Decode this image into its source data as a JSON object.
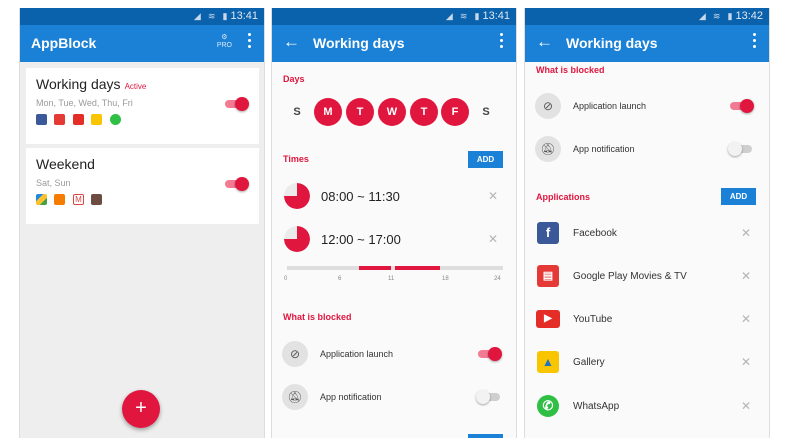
{
  "status": {
    "time1": "13:41",
    "time2": "13:41",
    "time3": "13:42"
  },
  "screen1": {
    "title": "AppBlock",
    "pro_label": "PRO",
    "profiles": [
      {
        "name": "Working days",
        "badge": "Active",
        "days": "Mon, Tue, Wed, Thu, Fri",
        "enabled": true,
        "apps": [
          "facebook-icon",
          "movies-icon",
          "youtube-icon",
          "gallery-icon",
          "whatsapp-icon"
        ]
      },
      {
        "name": "Weekend",
        "badge": "",
        "days": "Sat, Sun",
        "enabled": true,
        "apps": [
          "drive-icon",
          "blogger-icon",
          "gmail-icon",
          "book-icon"
        ]
      }
    ],
    "fab": "+"
  },
  "screen2": {
    "title": "Working days",
    "days_header": "Days",
    "days": [
      {
        "label": "S",
        "on": false
      },
      {
        "label": "M",
        "on": true
      },
      {
        "label": "T",
        "on": true
      },
      {
        "label": "W",
        "on": true
      },
      {
        "label": "T",
        "on": true
      },
      {
        "label": "F",
        "on": true
      },
      {
        "label": "S",
        "on": false
      }
    ],
    "times_header": "Times",
    "add_label": "ADD",
    "times": [
      {
        "range": "08:00 ~ 11:30"
      },
      {
        "range": "12:00 ~ 17:00"
      }
    ],
    "timeline_ticks": [
      "0",
      "6",
      "11",
      "18",
      "24"
    ],
    "blocked_header": "What is blocked",
    "blocked": [
      {
        "label": "Application launch",
        "enabled": true
      },
      {
        "label": "App notification",
        "enabled": false
      }
    ]
  },
  "screen3": {
    "title": "Working days",
    "blocked_header": "What is blocked",
    "blocked": [
      {
        "label": "Application launch",
        "enabled": true
      },
      {
        "label": "App notification",
        "enabled": false
      }
    ],
    "apps_header": "Applications",
    "add_label": "ADD",
    "apps": [
      {
        "name": "Facebook",
        "icon": "facebook-icon",
        "color": "#3b5998",
        "glyph": "f"
      },
      {
        "name": "Google Play Movies & TV",
        "icon": "movies-icon",
        "color": "#e53935",
        "glyph": "▤"
      },
      {
        "name": "YouTube",
        "icon": "youtube-icon",
        "color": "#e52d27",
        "glyph": "▶"
      },
      {
        "name": "Gallery",
        "icon": "gallery-icon",
        "color": "#f9c400",
        "glyph": "▲"
      },
      {
        "name": "WhatsApp",
        "icon": "whatsapp-icon",
        "color": "#2fbf44",
        "glyph": "✆"
      }
    ]
  },
  "colors": {
    "primary": "#1a81d6",
    "status_bar": "#0a62ad",
    "accent": "#e0163f"
  }
}
